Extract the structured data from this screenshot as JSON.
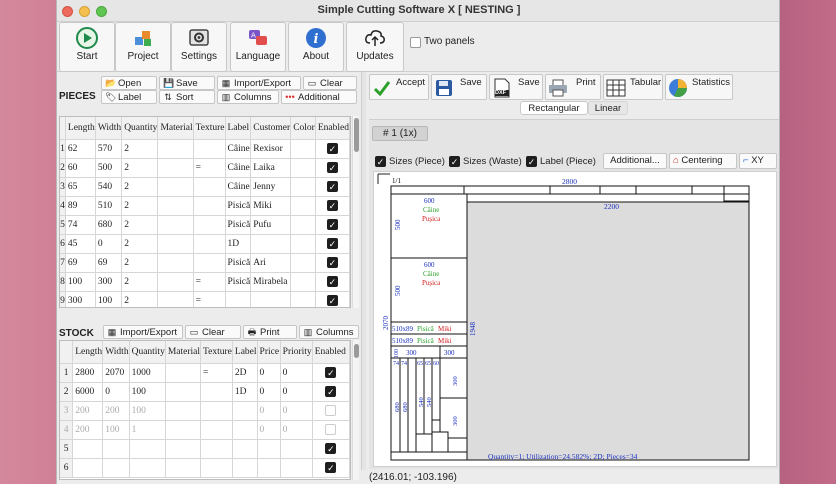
{
  "window": {
    "title": "Simple Cutting Software X [ NESTING ]"
  },
  "toolbar": {
    "buttons": [
      {
        "label": "Start",
        "icon": "start-icon"
      },
      {
        "label": "Project",
        "icon": "project-icon"
      },
      {
        "label": "Settings",
        "icon": "settings-icon"
      },
      {
        "label": "Language",
        "icon": "language-icon"
      },
      {
        "label": "About",
        "icon": "about-icon"
      },
      {
        "label": "Updates",
        "icon": "cloud-upload-icon"
      }
    ],
    "two_panels_label": "Two panels",
    "two_panels_checked": false
  },
  "pieces": {
    "title": "PIECES",
    "menu": {
      "open": "Open",
      "save": "Save",
      "import_export": "Import/Export",
      "clear": "Clear",
      "label": "Label",
      "sort": "Sort",
      "columns": "Columns",
      "additional": "Additional"
    },
    "columns": [
      "Length",
      "Width",
      "Quantity",
      "Material",
      "Texture",
      "Label",
      "Customer",
      "Color",
      "Enabled"
    ],
    "rows": [
      {
        "n": "1",
        "length": "62",
        "width": "570",
        "quantity": "2",
        "material": "",
        "texture": "",
        "label": "Câine",
        "customer": "Rexisor",
        "color": "",
        "enabled": true
      },
      {
        "n": "2",
        "length": "60",
        "width": "500",
        "quantity": "2",
        "material": "",
        "texture": "=",
        "label": "Câine",
        "customer": "Laika",
        "color": "",
        "enabled": true
      },
      {
        "n": "3",
        "length": "65",
        "width": "540",
        "quantity": "2",
        "material": "",
        "texture": "",
        "label": "Câine",
        "customer": "Jenny",
        "color": "",
        "enabled": true
      },
      {
        "n": "4",
        "length": "89",
        "width": "510",
        "quantity": "2",
        "material": "",
        "texture": "",
        "label": "Pisică",
        "customer": "Miki",
        "color": "",
        "enabled": true
      },
      {
        "n": "5",
        "length": "74",
        "width": "680",
        "quantity": "2",
        "material": "",
        "texture": "",
        "label": "Pisică",
        "customer": "Pufu",
        "color": "",
        "enabled": true
      },
      {
        "n": "6",
        "length": "45",
        "width": "0",
        "quantity": "2",
        "material": "",
        "texture": "",
        "label": "1D",
        "customer": "",
        "color": "",
        "enabled": true
      },
      {
        "n": "7",
        "length": "69",
        "width": "69",
        "quantity": "2",
        "material": "",
        "texture": "",
        "label": "Pisică",
        "customer": "Ari",
        "color": "",
        "enabled": true
      },
      {
        "n": "8",
        "length": "100",
        "width": "300",
        "quantity": "2",
        "material": "",
        "texture": "=",
        "label": "Pisică",
        "customer": "Mirabela",
        "color": "",
        "enabled": true
      },
      {
        "n": "9",
        "length": "300",
        "width": "100",
        "quantity": "2",
        "material": "",
        "texture": "=",
        "label": "",
        "customer": "",
        "color": "",
        "enabled": true
      }
    ]
  },
  "stock": {
    "title": "STOCK",
    "menu": {
      "import_export": "Import/Export",
      "clear": "Clear",
      "print": "Print",
      "columns": "Columns"
    },
    "columns": [
      "Length",
      "Width",
      "Quantity",
      "Material",
      "Texture",
      "Label",
      "Price",
      "Priority",
      "Enabled"
    ],
    "rows": [
      {
        "n": "1",
        "length": "2800",
        "width": "2070",
        "quantity": "1000",
        "material": "",
        "texture": "=",
        "label": "2D",
        "price": "0",
        "priority": "0",
        "enabled": true,
        "disabled_row": false
      },
      {
        "n": "2",
        "length": "6000",
        "width": "0",
        "quantity": "100",
        "material": "",
        "texture": "",
        "label": "1D",
        "price": "0",
        "priority": "0",
        "enabled": true,
        "disabled_row": false
      },
      {
        "n": "3",
        "length": "200",
        "width": "200",
        "quantity": "100",
        "material": "",
        "texture": "",
        "label": "",
        "price": "0",
        "priority": "0",
        "enabled": false,
        "disabled_row": true
      },
      {
        "n": "4",
        "length": "200",
        "width": "100",
        "quantity": "1",
        "material": "",
        "texture": "",
        "label": "",
        "price": "0",
        "priority": "0",
        "enabled": false,
        "disabled_row": true
      },
      {
        "n": "5",
        "length": "",
        "width": "",
        "quantity": "",
        "material": "",
        "texture": "",
        "label": "",
        "price": "",
        "priority": "",
        "enabled": true,
        "disabled_row": false
      },
      {
        "n": "6",
        "length": "",
        "width": "",
        "quantity": "",
        "material": "",
        "texture": "",
        "label": "",
        "price": "",
        "priority": "",
        "enabled": true,
        "disabled_row": false
      }
    ]
  },
  "results": {
    "buttons": {
      "accept": "Accept",
      "save": "Save",
      "save_dxf": "Save",
      "print": "Print",
      "tabular": "Tabular",
      "statistics": "Statistics"
    },
    "dxf_badge": "DXF",
    "modes": [
      "Rectangular",
      "Linear"
    ],
    "active_mode": "Rectangular",
    "sheet_tab": "# 1 (1x)",
    "options": {
      "sizes_piece": "Sizes (Piece)",
      "sizes_waste": "Sizes (Waste)",
      "label_piece": "Label (Piece)",
      "additional": "Additional...",
      "centering": "Centering",
      "xy": "XY"
    },
    "layout_texts": {
      "sheet_index": "1/1",
      "top_length": "2800",
      "waste_width": "2200",
      "sheet_height": "2070",
      "right_dim": "1948",
      "p600": "600",
      "p500": "500",
      "caine": "Câine",
      "pusica": "Pușica",
      "strip_dim": "510x89",
      "strip_label": "Pisică",
      "strip_owner": "Miki",
      "d300": "300",
      "d100": "100",
      "d74": "74",
      "d65": "65",
      "d60": "60",
      "d540": "540",
      "d680": "680",
      "d510": "510",
      "summary": "Quantity=1; Utilization=24.582%; 2D; Pieces=34"
    },
    "coords": "(2416.01; -103.196)"
  }
}
